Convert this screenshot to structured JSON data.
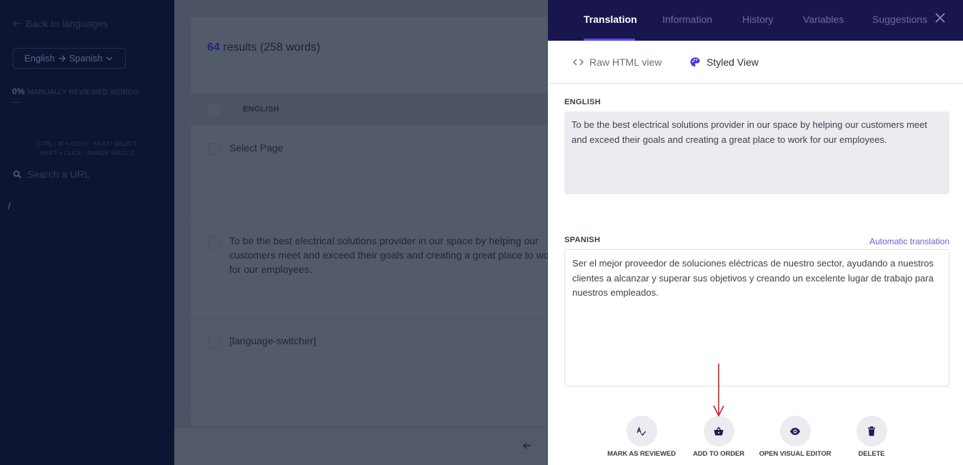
{
  "sidebar": {
    "back_label": "Back to languages",
    "language_pair": {
      "source": "English",
      "target": "Spanish"
    },
    "reviewed": {
      "percent": "0%",
      "label": "MANUALLY REVIEWED WORDS"
    },
    "hints": [
      "CTRL / ⌘ + CLICK - MULTI SELECT",
      "SHIFT + CLICK - RANGE SELECT"
    ],
    "search_placeholder": "Search a URL",
    "path": "/"
  },
  "main": {
    "results_count": "64",
    "results_suffix": "results (258 words)",
    "column_header": "ENGLISH",
    "rows": [
      {
        "lines": [
          "Select Page"
        ]
      },
      {
        "lines": [
          "To be the best electrical solutions provider in our space by helping our",
          "customers meet and exceed their goals and creating a great place to work",
          "for our employees."
        ]
      },
      {
        "lines": [
          "[language-switcher]"
        ]
      }
    ],
    "pager_prev_icon": "arrow-left-icon"
  },
  "panel": {
    "tabs": [
      {
        "label": "Translation",
        "active": true
      },
      {
        "label": "Information",
        "active": false
      },
      {
        "label": "History",
        "active": false
      },
      {
        "label": "Variables",
        "active": false
      },
      {
        "label": "Suggestions",
        "active": false
      }
    ],
    "views": {
      "raw": "Raw HTML view",
      "styled": "Styled View"
    },
    "source": {
      "label": "ENGLISH",
      "text": "To be the best electrical solutions provider in our space by helping our customers meet and exceed their goals and creating a great place to work for our employees."
    },
    "target": {
      "label": "SPANISH",
      "auto_label": "Automatic translation",
      "text": "Ser el mejor proveedor de soluciones eléctricas de nuestro sector, ayudando a nuestros clientes a alcanzar y superar sus objetivos y creando un excelente lugar de trabajo para nuestros empleados."
    },
    "actions": [
      {
        "label": "MARK AS REVIEWED",
        "icon": "spellcheck-icon"
      },
      {
        "label": "ADD TO ORDER",
        "icon": "basket-icon"
      },
      {
        "label": "OPEN VISUAL EDITOR",
        "icon": "eye-icon"
      },
      {
        "label": "DELETE",
        "icon": "trash-icon"
      }
    ]
  },
  "colors": {
    "panel_header": "#19164f",
    "accent": "#5a4be0",
    "annotation_arrow": "#d0202a"
  }
}
